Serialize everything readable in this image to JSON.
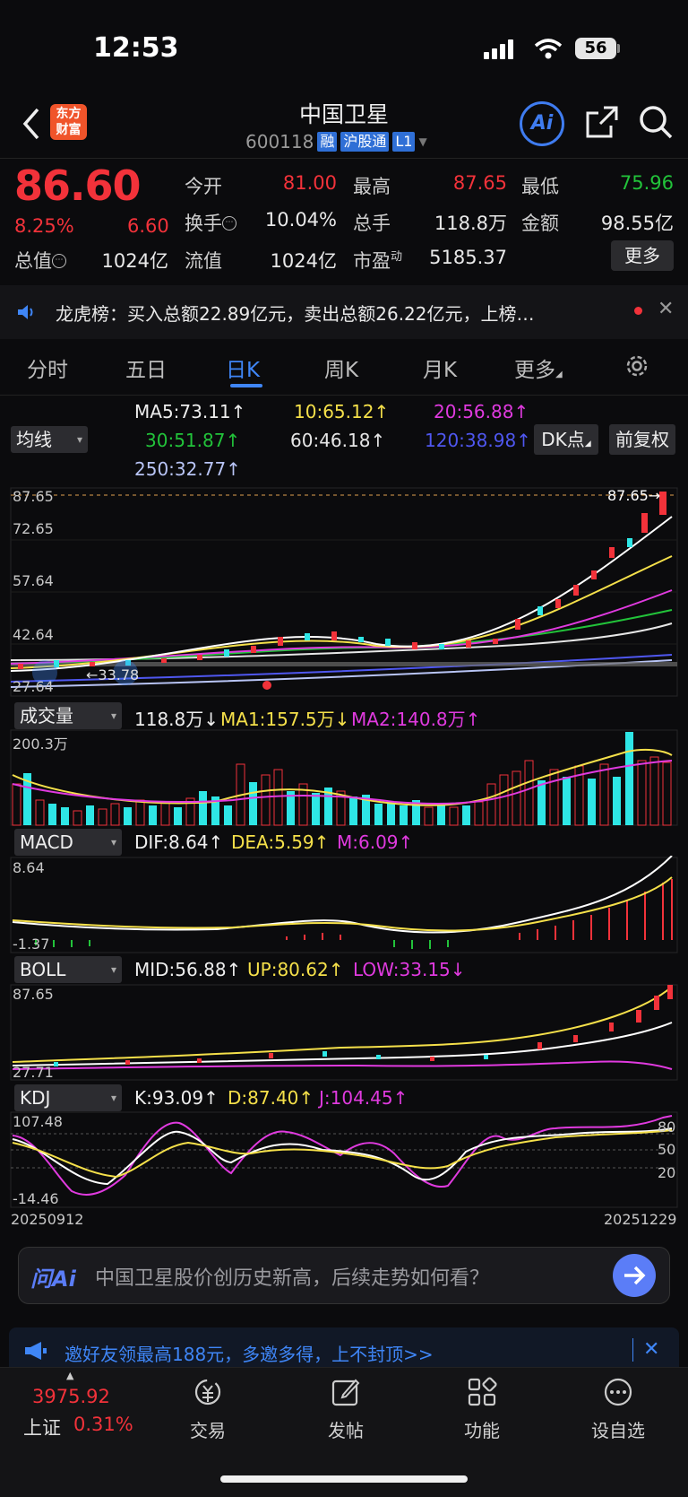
{
  "status_bar": {
    "time": "12:53",
    "battery": "56"
  },
  "header": {
    "logo_line1": "东方",
    "logo_line2": "财富",
    "title": "中国卫星",
    "code": "600118",
    "tags": [
      "融",
      "沪股通",
      "L1"
    ],
    "ai_label": "Ai"
  },
  "quote": {
    "price": "86.60",
    "change_pct": "8.25%",
    "change": "6.60",
    "open_label": "今开",
    "open": "81.00",
    "high_label": "最高",
    "high": "87.65",
    "low_label": "最低",
    "low": "75.96",
    "turnover_label": "换手",
    "turnover": "10.04%",
    "volume_label": "总手",
    "volume": "118.8万",
    "amount_label": "金额",
    "amount": "98.55亿",
    "mktcap_label": "总值",
    "mktcap": "1024亿",
    "float_label": "流值",
    "float": "1024亿",
    "pe_label": "市盈",
    "pe_sup": "动",
    "pe": "5185.37",
    "more": "更多"
  },
  "notice": {
    "text": "龙虎榜：买入总额22.89亿元，卖出总额26.22亿元，上榜…"
  },
  "tabs": [
    {
      "label": "分时"
    },
    {
      "label": "五日"
    },
    {
      "label": "日K"
    },
    {
      "label": "周K"
    },
    {
      "label": "月K"
    },
    {
      "label": "更多"
    }
  ],
  "ma_panel": {
    "selector": "均线",
    "ma5": "MA5:73.11↑",
    "ma10": "10:65.12↑",
    "ma20": "20:56.88↑",
    "ma30": "30:51.87↑",
    "ma60": "60:46.18↑",
    "ma120": "120:38.98↑",
    "ma250": "250:32.77↑",
    "dk_button": "DK点",
    "adjust_button": "前复权"
  },
  "kline": {
    "y_labels": [
      "87.65",
      "72.65",
      "57.64",
      "42.64",
      "27.64"
    ],
    "high_marker": "87.65→",
    "low_marker": "←33.78"
  },
  "volume_panel": {
    "selector": "成交量",
    "vol": "118.8万↓",
    "ma1": "MA1:157.5万↓",
    "ma2": "MA2:140.8万↑",
    "top_label": "200.3万"
  },
  "macd_panel": {
    "selector": "MACD",
    "dif": "DIF:8.64↑",
    "dea": "DEA:5.59↑",
    "m": "M:6.09↑",
    "top_label": "8.64",
    "bottom_label": "-1.37"
  },
  "boll_panel": {
    "selector": "BOLL",
    "mid": "MID:56.88↑",
    "up": "UP:80.62↑",
    "low": "LOW:33.15↓",
    "top_label": "87.65",
    "bottom_label": "27.71"
  },
  "kdj_panel": {
    "selector": "KDJ",
    "k": "K:93.09↑",
    "d": "D:87.40↑",
    "j": "J:104.45↑",
    "top_label": "107.48",
    "bottom_label": "-14.46",
    "levels": [
      "80",
      "50",
      "20"
    ],
    "start_date": "20250912",
    "end_date": "20251229"
  },
  "ask": {
    "logo": "问Ai",
    "placeholder": "中国卫星股价创历史新高，后续走势如何看？"
  },
  "promo": {
    "text": "邀好友领最高188元，多邀多得，上不封顶>>"
  },
  "bottom_nav": {
    "index_value": "3975.92",
    "index_name": "上证",
    "index_pct": "0.31%",
    "items": [
      {
        "label": "交易"
      },
      {
        "label": "发帖"
      },
      {
        "label": "功能"
      },
      {
        "label": "设自选"
      }
    ]
  },
  "colors": {
    "up": "#f2323a",
    "down": "#22c33a",
    "cyan": "#2ee6e6",
    "accent": "#3f86f7",
    "yellow": "#f5e04a",
    "magenta": "#e03adf"
  }
}
